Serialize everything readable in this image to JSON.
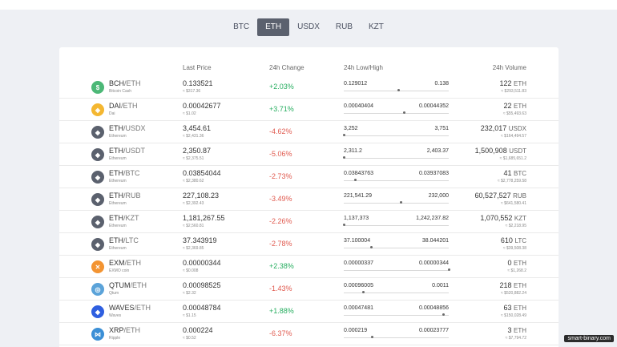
{
  "tabs": [
    {
      "label": "BTC",
      "active": false
    },
    {
      "label": "ETH",
      "active": true
    },
    {
      "label": "USDX",
      "active": false
    },
    {
      "label": "RUB",
      "active": false
    },
    {
      "label": "KZT",
      "active": false
    }
  ],
  "headers": {
    "last_price": "Last Price",
    "change": "24h Change",
    "lowhigh": "24h Low/High",
    "volume": "24h Volume"
  },
  "rows": [
    {
      "icon": "bch-icon",
      "color": "#4cb877",
      "glyph": "$",
      "base": "BCH",
      "quote": "/ETH",
      "name": "Bitcoin Cash",
      "price": "0.133521",
      "price_sub": "≈ $317.36",
      "change": "+2.03%",
      "trend": "pos",
      "low": "0.129012",
      "high": "0.138",
      "position": 0.52,
      "volume": "122",
      "vol_cur": "ETH",
      "vol_sub": "≈ $293,511.83"
    },
    {
      "icon": "dai-icon",
      "color": "#f4b731",
      "glyph": "◈",
      "base": "DAI",
      "quote": "/ETH",
      "name": "Dai",
      "price": "0.00042677",
      "price_sub": "≈ $1.02",
      "change": "+3.71%",
      "trend": "pos",
      "low": "0.00040404",
      "high": "0.00044352",
      "position": 0.57,
      "volume": "22",
      "vol_cur": "ETH",
      "vol_sub": "≈ $55,493.63"
    },
    {
      "icon": "eth-icon",
      "color": "#5b616e",
      "glyph": "◆",
      "base": "ETH",
      "quote": "/USDX",
      "name": "Ethereum",
      "price": "3,454.61",
      "price_sub": "≈ $2,431.36",
      "change": "-4.62%",
      "trend": "neg",
      "low": "3,252",
      "high": "3,751",
      "position": 0.0,
      "volume": "232,017",
      "vol_cur": "USDX",
      "vol_sub": "≈ $164,494.57"
    },
    {
      "icon": "eth-icon",
      "color": "#5b616e",
      "glyph": "◆",
      "base": "ETH",
      "quote": "/USDT",
      "name": "Ethereum",
      "price": "2,350.87",
      "price_sub": "≈ $2,375.51",
      "change": "-5.06%",
      "trend": "neg",
      "low": "2,311.2",
      "high": "2,403.37",
      "position": 0.0,
      "volume": "1,500,908",
      "vol_cur": "USDT",
      "vol_sub": "≈ $1,685,651.2"
    },
    {
      "icon": "eth-icon",
      "color": "#5b616e",
      "glyph": "◆",
      "base": "ETH",
      "quote": "/BTC",
      "name": "Ethereum",
      "price": "0.03854044",
      "price_sub": "≈ $2,380.62",
      "change": "-2.73%",
      "trend": "neg",
      "low": "0.03843763",
      "high": "0.03937083",
      "position": 0.11,
      "volume": "41",
      "vol_cur": "BTC",
      "vol_sub": "≈ $2,778,259.58"
    },
    {
      "icon": "eth-icon",
      "color": "#5b616e",
      "glyph": "◆",
      "base": "ETH",
      "quote": "/RUB",
      "name": "Ethereum",
      "price": "227,108.23",
      "price_sub": "≈ $2,392.43",
      "change": "-3.49%",
      "trend": "neg",
      "low": "221,541.29",
      "high": "232,000",
      "position": 0.54,
      "volume": "60,527,527",
      "vol_cur": "RUB",
      "vol_sub": "≈ $641,580.41"
    },
    {
      "icon": "eth-icon",
      "color": "#5b616e",
      "glyph": "◆",
      "base": "ETH",
      "quote": "/KZT",
      "name": "Ethereum",
      "price": "1,181,267.55",
      "price_sub": "≈ $2,560.81",
      "change": "-2.26%",
      "trend": "neg",
      "low": "1,137,373",
      "high": "1,242,237.82",
      "position": 0.0,
      "volume": "1,070,552",
      "vol_cur": "KZT",
      "vol_sub": "≈ $2,218.95"
    },
    {
      "icon": "eth-icon",
      "color": "#5b616e",
      "glyph": "◆",
      "base": "ETH",
      "quote": "/LTC",
      "name": "Ethereum",
      "price": "37.343919",
      "price_sub": "≈ $2,369.85",
      "change": "-2.78%",
      "trend": "neg",
      "low": "37.100004",
      "high": "38.044201",
      "position": 0.26,
      "volume": "610",
      "vol_cur": "LTC",
      "vol_sub": "≈ $39,508.38"
    },
    {
      "icon": "exm-icon",
      "color": "#f39432",
      "glyph": "✕",
      "base": "EXM",
      "quote": "/ETH",
      "name": "EXMO coin",
      "price": "0.00000344",
      "price_sub": "≈ $0.008",
      "change": "+2.38%",
      "trend": "pos",
      "low": "0.00000337",
      "high": "0.00000344",
      "position": 1.0,
      "volume": "0",
      "vol_cur": "ETH",
      "vol_sub": "≈ $1,268.2"
    },
    {
      "icon": "qtum-icon",
      "color": "#5ba3d9",
      "glyph": "◎",
      "base": "QTUM",
      "quote": "/ETH",
      "name": "Qtum",
      "price": "0.00098525",
      "price_sub": "≈ $2.32",
      "change": "-1.43%",
      "trend": "neg",
      "low": "0.00096005",
      "high": "0.0011",
      "position": 0.18,
      "volume": "218",
      "vol_cur": "ETH",
      "vol_sub": "≈ $520,882.24"
    },
    {
      "icon": "waves-icon",
      "color": "#2f5fe0",
      "glyph": "◆",
      "base": "WAVES",
      "quote": "/ETH",
      "name": "Waves",
      "price": "0.00048784",
      "price_sub": "≈ $1.15",
      "change": "+1.88%",
      "trend": "pos",
      "low": "0.00047481",
      "high": "0.00048856",
      "position": 0.95,
      "volume": "63",
      "vol_cur": "ETH",
      "vol_sub": "≈ $150,028.49"
    },
    {
      "icon": "xrp-icon",
      "color": "#3b8fd6",
      "glyph": "⋈",
      "base": "XRP",
      "quote": "/ETH",
      "name": "Ripple",
      "price": "0.000224",
      "price_sub": "≈ $0.52",
      "change": "-6.37%",
      "trend": "neg",
      "low": "0.000219",
      "high": "0.00023777",
      "position": 0.27,
      "volume": "3",
      "vol_cur": "ETH",
      "vol_sub": "≈ $7,794.72"
    }
  ],
  "watermark": "smart-binary.com"
}
